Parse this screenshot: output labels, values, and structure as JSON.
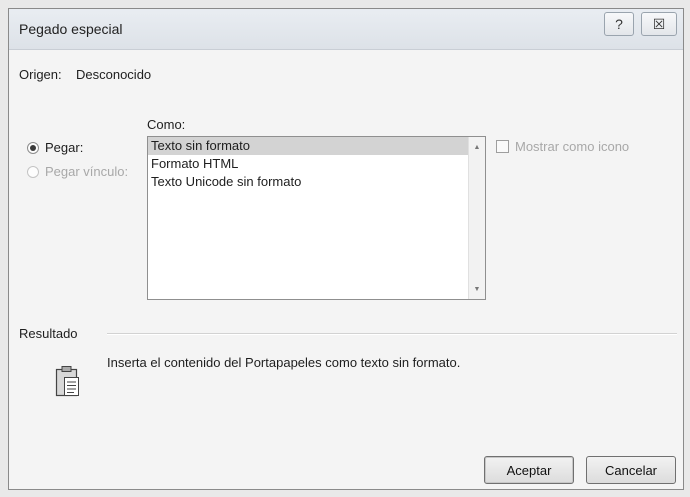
{
  "window": {
    "title": "Pegado especial",
    "help_glyph": "?",
    "close_glyph": "☒"
  },
  "origin": {
    "label": "Origen:",
    "value": "Desconocido"
  },
  "options": {
    "paste_label": "Pegar:",
    "paste_link_label": "Pegar vínculo:",
    "as_label": "Como:",
    "formats": [
      "Texto sin formato",
      "Formato HTML",
      "Texto Unicode sin formato"
    ],
    "selected_index": 0,
    "show_as_icon_label": "Mostrar como icono"
  },
  "result": {
    "label": "Resultado",
    "description": "Inserta el contenido del Portapapeles como texto sin formato."
  },
  "buttons": {
    "ok": "Aceptar",
    "cancel": "Cancelar"
  }
}
